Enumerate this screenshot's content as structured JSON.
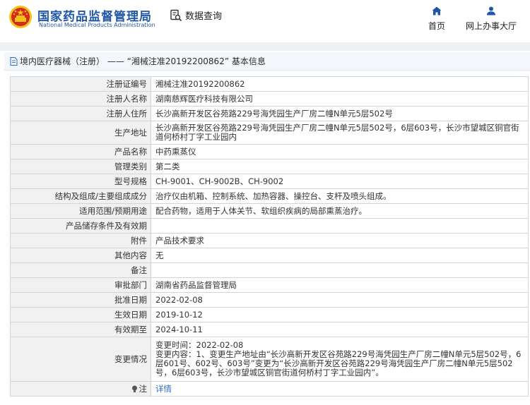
{
  "header": {
    "brand_cn": "国家药品监督管理局",
    "brand_en": "National Medical Products Administration",
    "nav": {
      "query_label": "数据查询",
      "home_label": "首页",
      "online_label": "网上办事大厅"
    },
    "colors": {
      "brand": "#1f57a6",
      "emblem_red": "#d42a1f",
      "emblem_gold": "#f3c218"
    }
  },
  "breadcrumb": {
    "text": "境内医疗器械（注册） ——  “湘械注准20192200862” 基本信息",
    "icon": "document-icon"
  },
  "details": {
    "rows": [
      {
        "label": "注册证编号",
        "value": "湘械注准20192200862"
      },
      {
        "label": "注册人名称",
        "value": "湖南慈辉医疗科技有限公司"
      },
      {
        "label": "注册人住所",
        "value": "长沙高新开发区谷苑路229号海凭园生产厂房二幢N单元5层502号"
      },
      {
        "label": "生产地址",
        "value": "长沙高新开发区谷苑路229号海凭园生产厂房二幢N单元5层502号，6层603号，长沙市望城区铜官街道何桥村丁字工业园内"
      },
      {
        "label": "产品名称",
        "value": "中药熏蒸仪"
      },
      {
        "label": "管理类别",
        "value": "第二类"
      },
      {
        "label": "型号规格",
        "value": "CH-9001、CH-9002B、CH-9002"
      },
      {
        "label": "结构及组成/主要组成成分",
        "value": "治疗仪由机箱、控制系统、加热容器、操控台、支杆及喷头组成。"
      },
      {
        "label": "适用范围/预期用途",
        "value": "配合药物，适用于人体关节、软组织疾病的局部熏蒸治疗。"
      },
      {
        "label": "产品储存条件及有效期",
        "value": ""
      },
      {
        "label": "附件",
        "value": "产品技术要求"
      },
      {
        "label": "其他内容",
        "value": "无"
      },
      {
        "label": "备注",
        "value": ""
      },
      {
        "label": "审批部门",
        "value": "湖南省药品监督管理局"
      },
      {
        "label": "批准日期",
        "value": "2022-02-08"
      },
      {
        "label": "生效日期",
        "value": "2019-10-12"
      },
      {
        "label": "有效期至",
        "value": "2024-10-11"
      }
    ],
    "change": {
      "label": "变更情况",
      "time": "变更时间：2022-02-08",
      "content": "变更内容：1、变更生产地址由“长沙高新开发区谷苑路229号海凭园生产厂房二幢N单元5层502号，6层601号、602号、603号”变更为“长沙高新开发区谷苑路229号海凭园生产厂房二幢N单元5层502号，6层603号，长沙市望城区铜官街道何桥村丁字工业园内”。"
    },
    "note": {
      "label": "注",
      "link": "详情"
    }
  }
}
